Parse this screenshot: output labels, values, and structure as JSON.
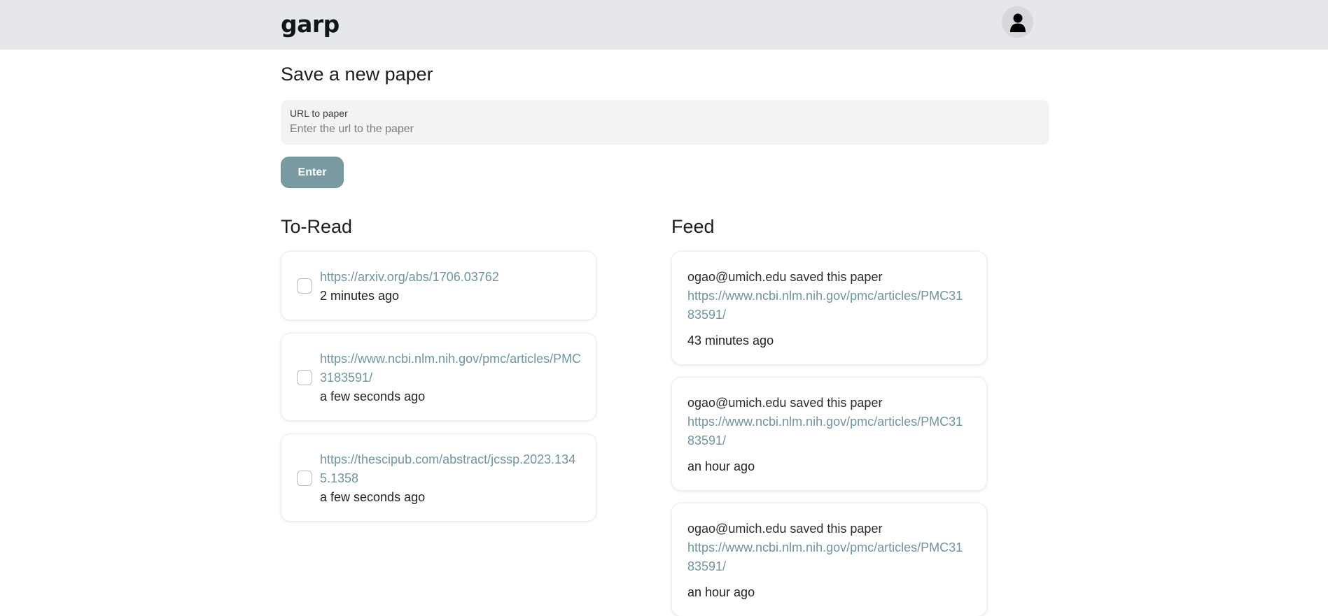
{
  "header": {
    "brand": "garp"
  },
  "save_section": {
    "title": "Save a new paper",
    "field_label": "URL to paper",
    "field_placeholder": "Enter the url to the paper",
    "field_value": "",
    "button_label": "Enter"
  },
  "to_read": {
    "title": "To-Read",
    "items": [
      {
        "url": "https://arxiv.org/abs/1706.03762",
        "time": "2 minutes ago",
        "checked": false
      },
      {
        "url": "https://www.ncbi.nlm.nih.gov/pmc/articles/PMC3183591/",
        "time": "a few seconds ago",
        "checked": false
      },
      {
        "url": "https://thescipub.com/abstract/jcssp.2023.1345.1358",
        "time": "a few seconds ago",
        "checked": false
      }
    ]
  },
  "feed": {
    "title": "Feed",
    "items": [
      {
        "who": "ogao@umich.edu saved this paper",
        "url": "https://www.ncbi.nlm.nih.gov/pmc/articles/PMC3183591/",
        "time": "43 minutes ago"
      },
      {
        "who": "ogao@umich.edu saved this paper",
        "url": "https://www.ncbi.nlm.nih.gov/pmc/articles/PMC3183591/",
        "time": "an hour ago"
      },
      {
        "who": "ogao@umich.edu saved this paper",
        "url": "https://www.ncbi.nlm.nih.gov/pmc/articles/PMC3183591/",
        "time": "an hour ago"
      }
    ]
  },
  "colors": {
    "accent": "#7a9aa2",
    "link": "#6f959e",
    "header_bg": "#e5e7ea"
  },
  "icons": {
    "avatar": "user-icon"
  }
}
